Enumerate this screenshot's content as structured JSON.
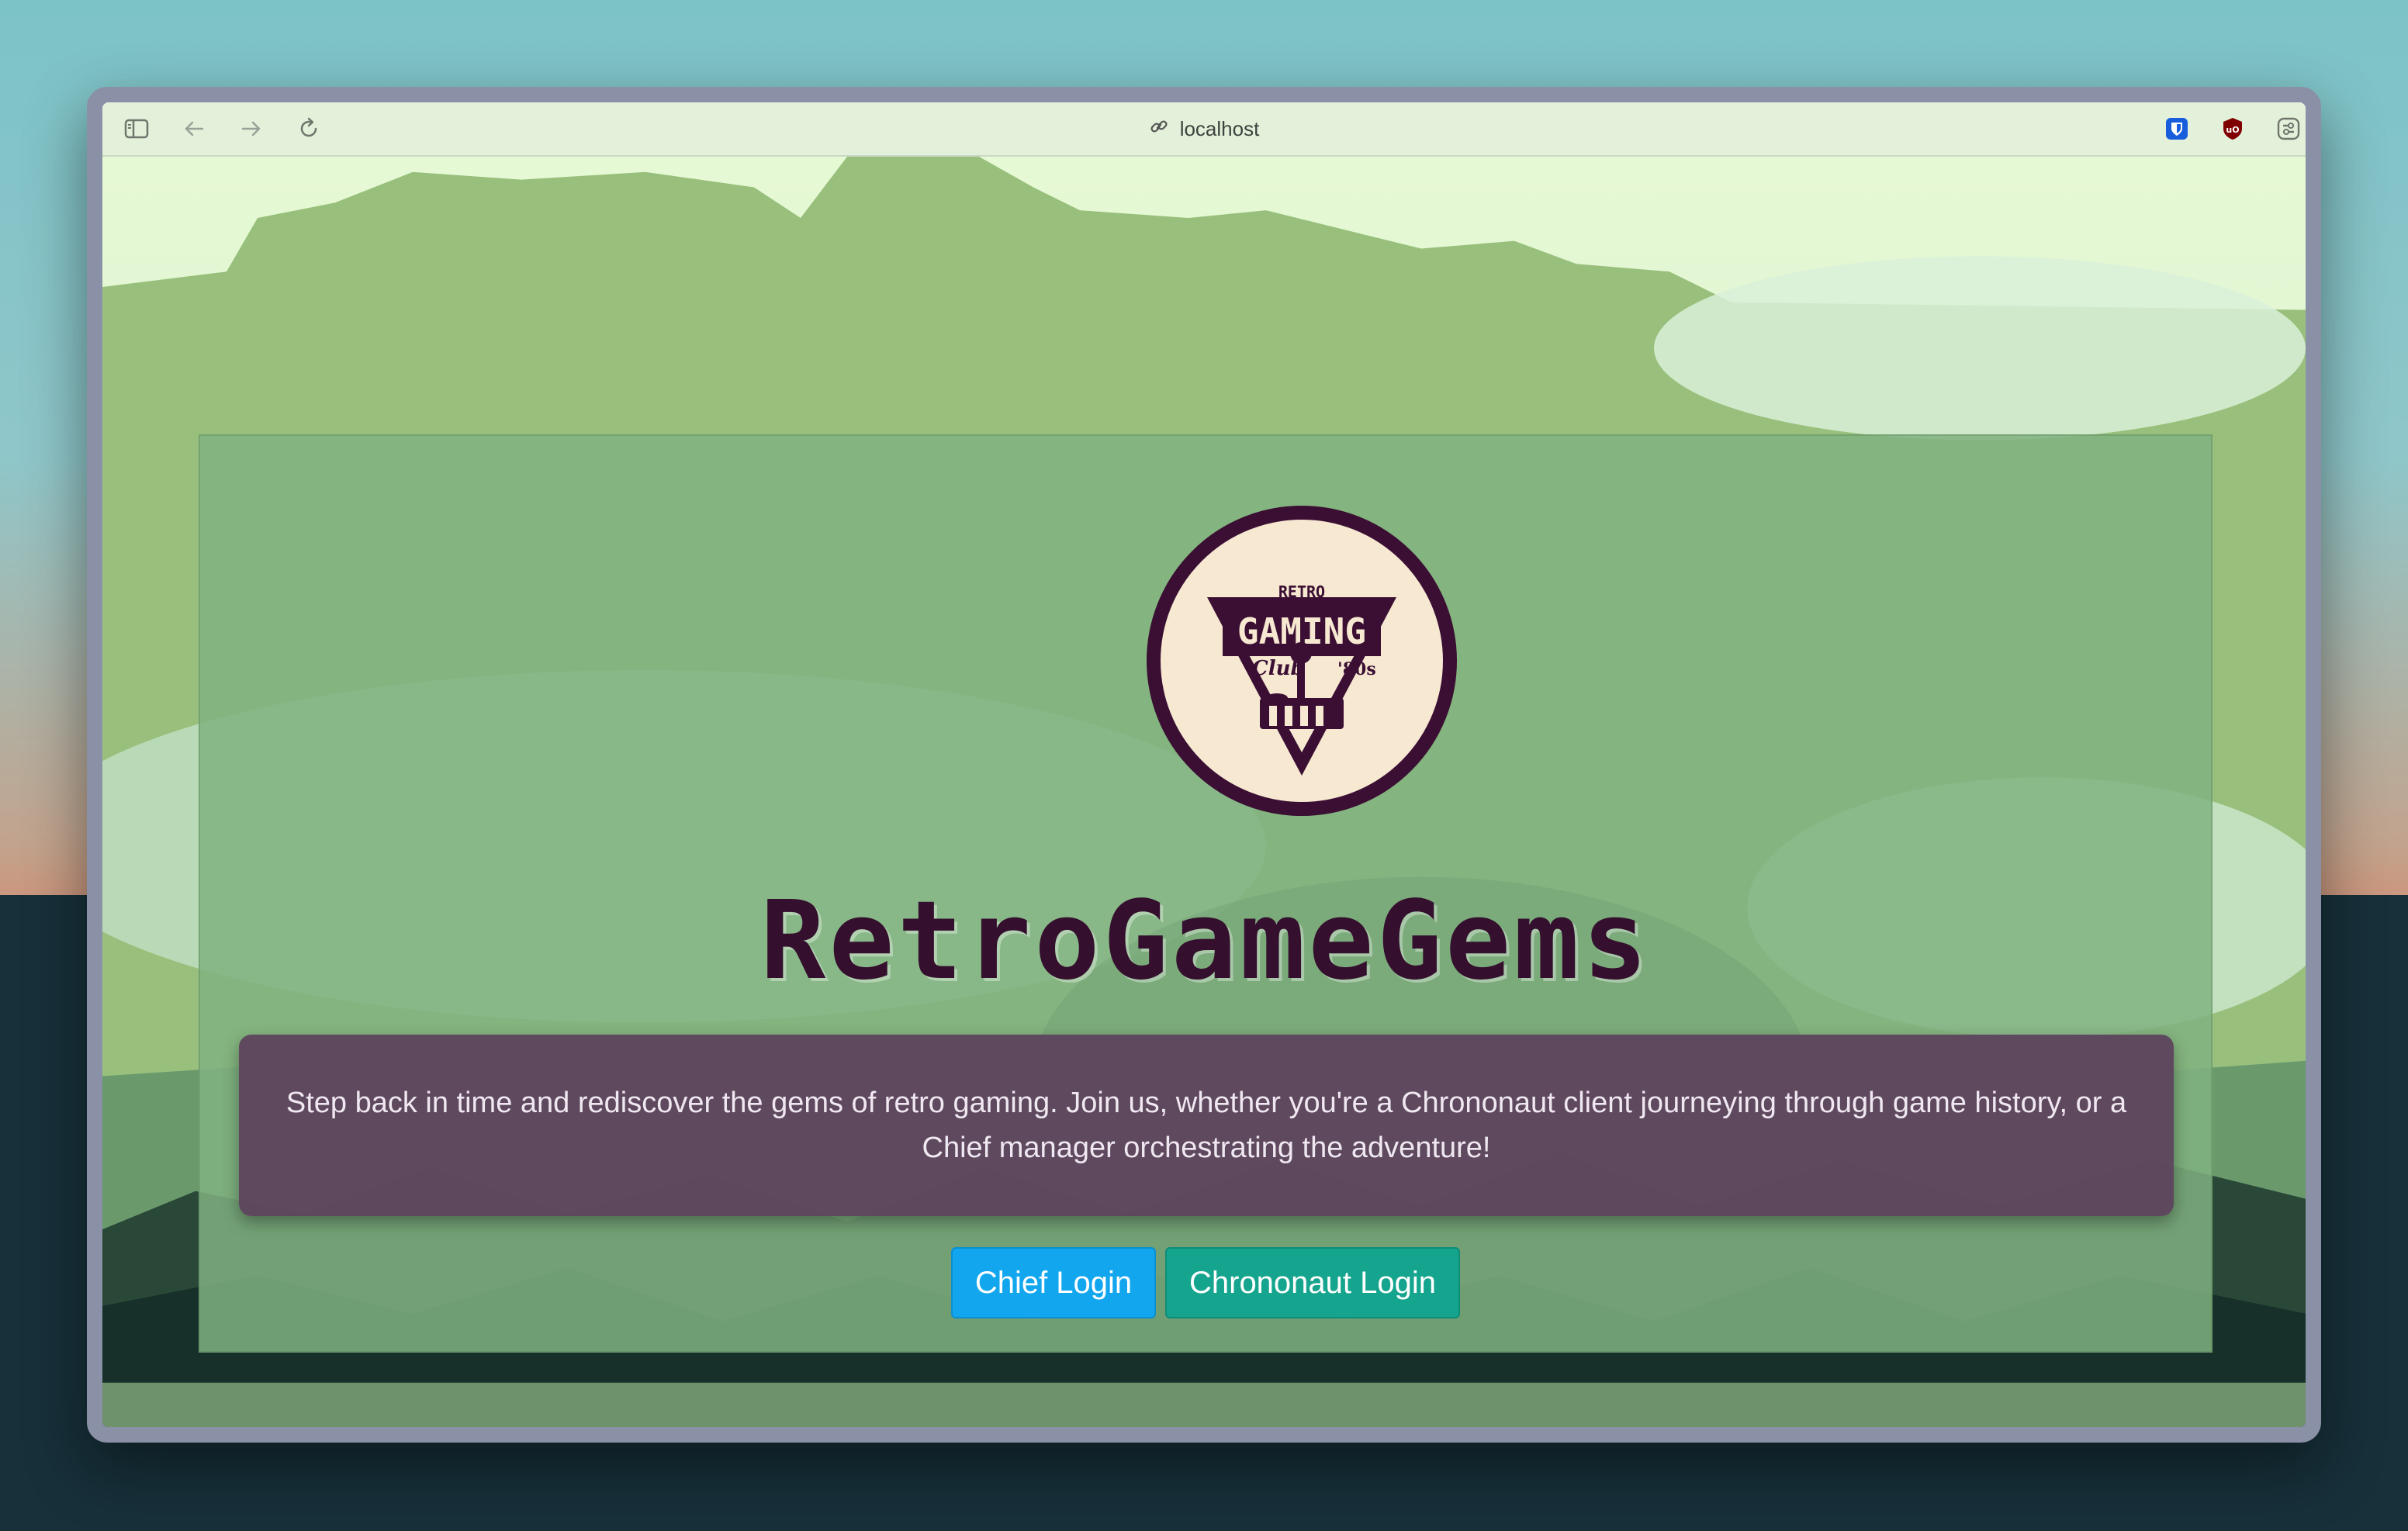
{
  "browser": {
    "url": "localhost",
    "toolbar_icons": [
      "sidebar-icon",
      "back-icon",
      "forward-icon",
      "reload-icon",
      "link-icon",
      "bitwarden-icon",
      "ublock-icon",
      "extension-icon",
      "split-view-icon"
    ]
  },
  "hero": {
    "logo_text": [
      "RETRO",
      "GAMING",
      "Club",
      "'80s"
    ],
    "title": "RetroGameGems",
    "description": "Step back in time and rediscover the gems of retro gaming. Join us, whether you're a Chrononaut client journeying through game history, or a Chief manager orchestrating the adventure!"
  },
  "buttons": {
    "chief": "Chief Login",
    "chrononaut": "Chrononaut Login"
  },
  "colors": {
    "title": "#35102e",
    "chief_button": "#11a6ee",
    "chrononaut_button": "#15a58e",
    "description_bg": "#5c405c"
  }
}
